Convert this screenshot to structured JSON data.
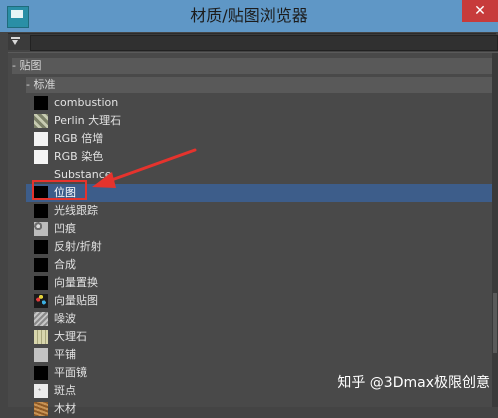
{
  "window": {
    "title": "材质/贴图浏览器",
    "close_glyph": "✕"
  },
  "filter": {
    "value": ""
  },
  "tree": {
    "group_maps": "- 贴图",
    "group_standard": "- 标准",
    "items": [
      {
        "label": "combustion",
        "icon": "black-swatch-icon",
        "color": "#000000"
      },
      {
        "label": "Perlin 大理石",
        "icon": "perlin-marble-swatch-icon",
        "color": "#9a9f84"
      },
      {
        "label": "RGB 倍增",
        "icon": "white-swatch-icon",
        "color": "#f4f4f4"
      },
      {
        "label": "RGB 染色",
        "icon": "white-swatch-icon",
        "color": "#f4f4f4"
      },
      {
        "label": "Substance",
        "icon": "none",
        "color": ""
      },
      {
        "label": "位图",
        "icon": "black-swatch-icon",
        "color": "#000000",
        "selected": true
      },
      {
        "label": "光线跟踪",
        "icon": "black-swatch-icon",
        "color": "#000000"
      },
      {
        "label": "凹痕",
        "icon": "dent-swatch-icon",
        "color": "#8c8c8c"
      },
      {
        "label": "反射/折射",
        "icon": "black-swatch-icon",
        "color": "#000000"
      },
      {
        "label": "合成",
        "icon": "black-swatch-icon",
        "color": "#000000"
      },
      {
        "label": "向量置换",
        "icon": "black-swatch-icon",
        "color": "#000000"
      },
      {
        "label": "向量贴图",
        "icon": "vector-map-swatch-icon",
        "color": "#2a2a2a"
      },
      {
        "label": "噪波",
        "icon": "noise-swatch-icon",
        "color": "#a8a8a8"
      },
      {
        "label": "大理石",
        "icon": "marble-swatch-icon",
        "color": "#c9c8a0"
      },
      {
        "label": "平铺",
        "icon": "tiles-swatch-icon",
        "color": "#b8b8b8"
      },
      {
        "label": "平面镜",
        "icon": "black-swatch-icon",
        "color": "#000000"
      },
      {
        "label": "斑点",
        "icon": "speckle-swatch-icon",
        "color": "#e0e0e0"
      },
      {
        "label": "木材",
        "icon": "wood-swatch-icon",
        "color": "#b07a3c"
      }
    ]
  },
  "watermark": "知乎 @3Dmax极限创意",
  "colors": {
    "selection": "#3d5d8a",
    "annotation": "#e5332d"
  }
}
